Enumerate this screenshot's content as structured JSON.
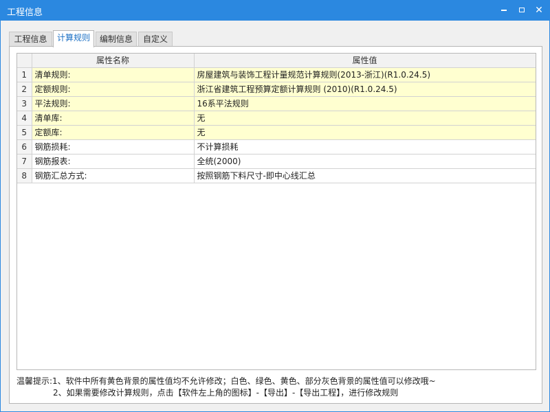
{
  "window": {
    "title": "工程信息"
  },
  "tabs": [
    {
      "label": "工程信息"
    },
    {
      "label": "计算规则"
    },
    {
      "label": "编制信息"
    },
    {
      "label": "自定义"
    }
  ],
  "grid": {
    "columns": [
      "属性名称",
      "属性值"
    ],
    "rows": [
      {
        "index": "1",
        "name": "清单规则:",
        "value": "房屋建筑与装饰工程计量规范计算规则(2013-浙江)(R1.0.24.5)",
        "bg": "yellow"
      },
      {
        "index": "2",
        "name": "定额规则:",
        "value": "浙江省建筑工程预算定额计算规则 (2010)(R1.0.24.5)",
        "bg": "yellow"
      },
      {
        "index": "3",
        "name": "平法规则:",
        "value": "16系平法规则",
        "bg": "yellow"
      },
      {
        "index": "4",
        "name": "清单库:",
        "value": "无",
        "bg": "yellow"
      },
      {
        "index": "5",
        "name": "定额库:",
        "value": "无",
        "bg": "yellow"
      },
      {
        "index": "6",
        "name": "钢筋损耗:",
        "value": "不计算损耗",
        "bg": "white"
      },
      {
        "index": "7",
        "name": "钢筋报表:",
        "value": "全统(2000)",
        "bg": "white"
      },
      {
        "index": "8",
        "name": "钢筋汇总方式:",
        "value": "按照钢筋下料尺寸-即中心线汇总",
        "bg": "white"
      }
    ]
  },
  "tip": {
    "line1": "温馨提示:1、软件中所有黄色背景的属性值均不允许修改；白色、绿色、黄色、部分灰色背景的属性值可以修改哦~",
    "line2": "2、如果需要修改计算规则，点击【软件左上角的图标】-【导出】-【导出工程】，进行修改规则"
  },
  "colors": {
    "titlebar": "#2b88e0",
    "readonly_bg": "#ffffd0",
    "editable_bg": "#ffffff",
    "active_tab_text": "#1a6fc4"
  }
}
